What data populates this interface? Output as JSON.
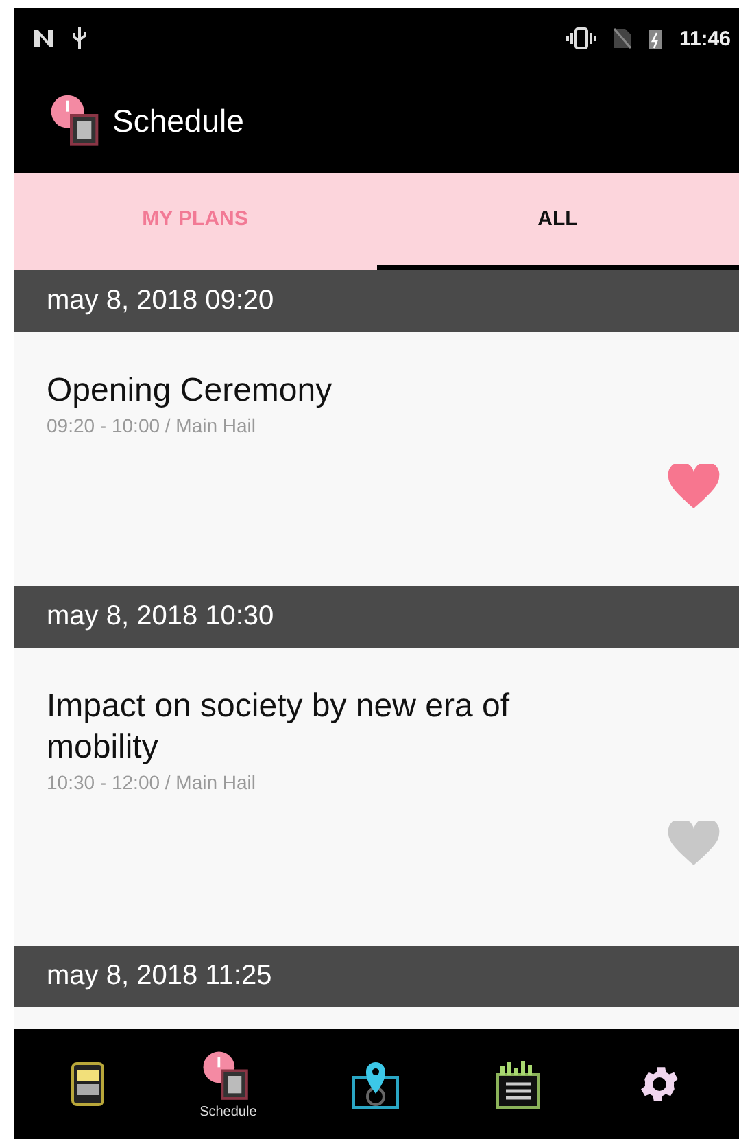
{
  "status_bar": {
    "time": "11:46"
  },
  "app_bar": {
    "title": "Schedule"
  },
  "tabs": [
    {
      "label": "MY PLANS",
      "selected": false
    },
    {
      "label": "ALL",
      "selected": true
    }
  ],
  "sessions": [
    {
      "header": "may 8, 2018 09:20",
      "title": "Opening Ceremony",
      "detail": "09:20 - 10:00 / Main Hail",
      "favorite": true
    },
    {
      "header": "may 8, 2018 10:30",
      "title": "Impact on society by new era of mobility",
      "detail": "10:30 - 12:00 / Main Hail",
      "favorite": false
    },
    {
      "header": "may 8, 2018 11:25"
    }
  ],
  "bottom_nav": [
    {
      "kind": "notes"
    },
    {
      "kind": "schedule",
      "label": "Schedule"
    },
    {
      "kind": "map"
    },
    {
      "kind": "list"
    },
    {
      "kind": "settings"
    }
  ]
}
